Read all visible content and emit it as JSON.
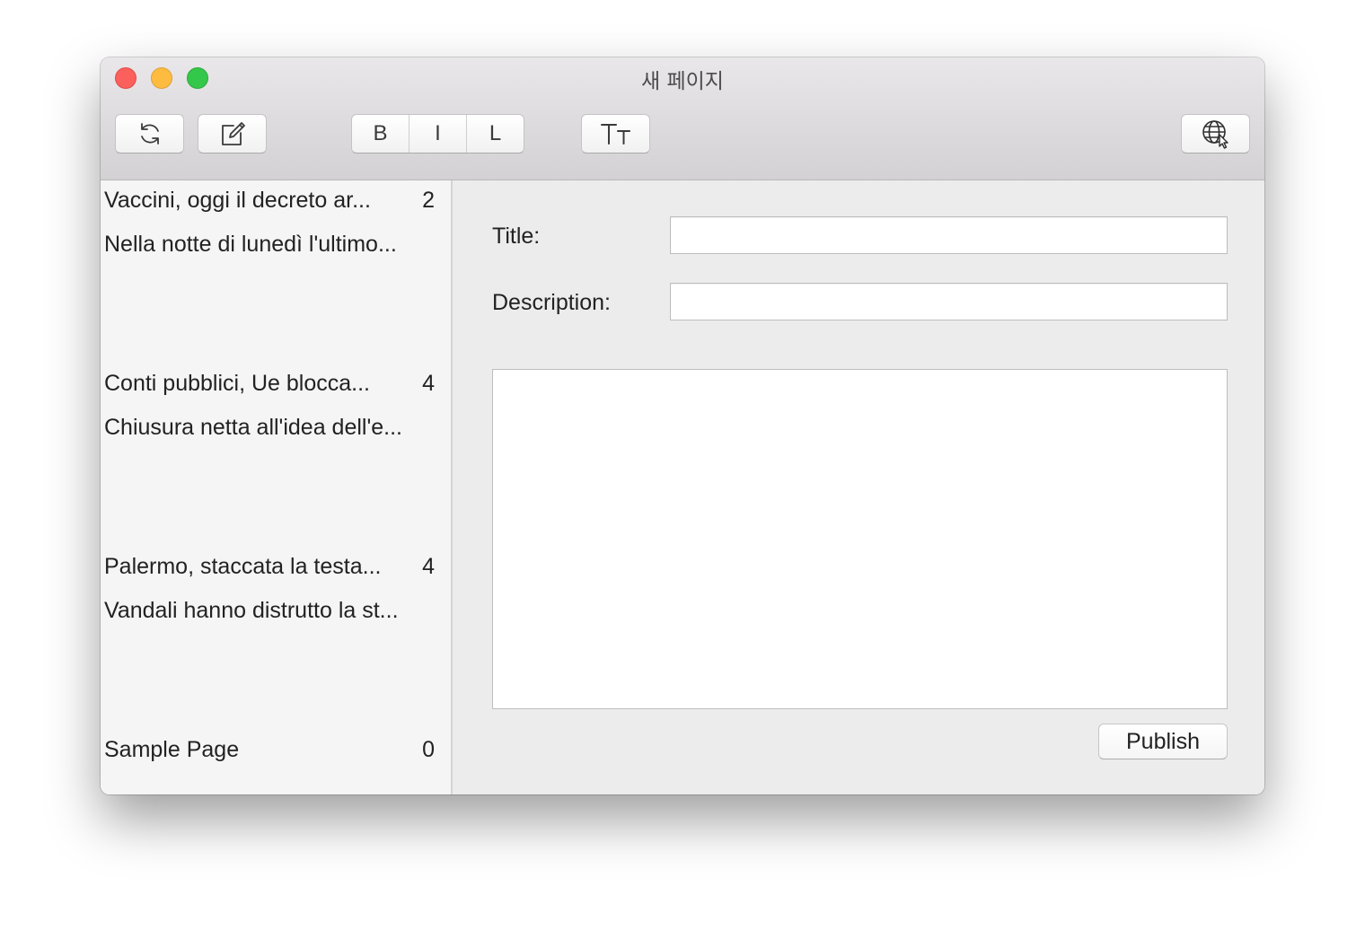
{
  "window": {
    "title": "새 페이지"
  },
  "toolbar": {
    "refresh_icon": "refresh-icon",
    "compose_icon": "compose-icon",
    "format_buttons": [
      "B",
      "I",
      "L"
    ],
    "text_size_label": "TT",
    "globe_icon": "globe-cursor-icon"
  },
  "sidebar": {
    "items": [
      {
        "title": "Vaccini, oggi il decreto ar...",
        "count": "2",
        "excerpt": "Nella notte di lunedì l'ultimo..."
      },
      {
        "title": "Conti pubblici, Ue blocca...",
        "count": "4",
        "excerpt": "Chiusura netta all'idea dell'e..."
      },
      {
        "title": "Palermo, staccata la testa...",
        "count": "4",
        "excerpt": "Vandali hanno distrutto la st..."
      },
      {
        "title": "Sample Page",
        "count": "0",
        "excerpt": ""
      }
    ]
  },
  "form": {
    "title_label": "Title:",
    "title_value": "",
    "description_label": "Description:",
    "description_value": "",
    "body_value": "",
    "publish_label": "Publish"
  },
  "colors": {
    "close": "#fc605c",
    "minimize": "#fdbc40",
    "maximize": "#34c84a"
  }
}
